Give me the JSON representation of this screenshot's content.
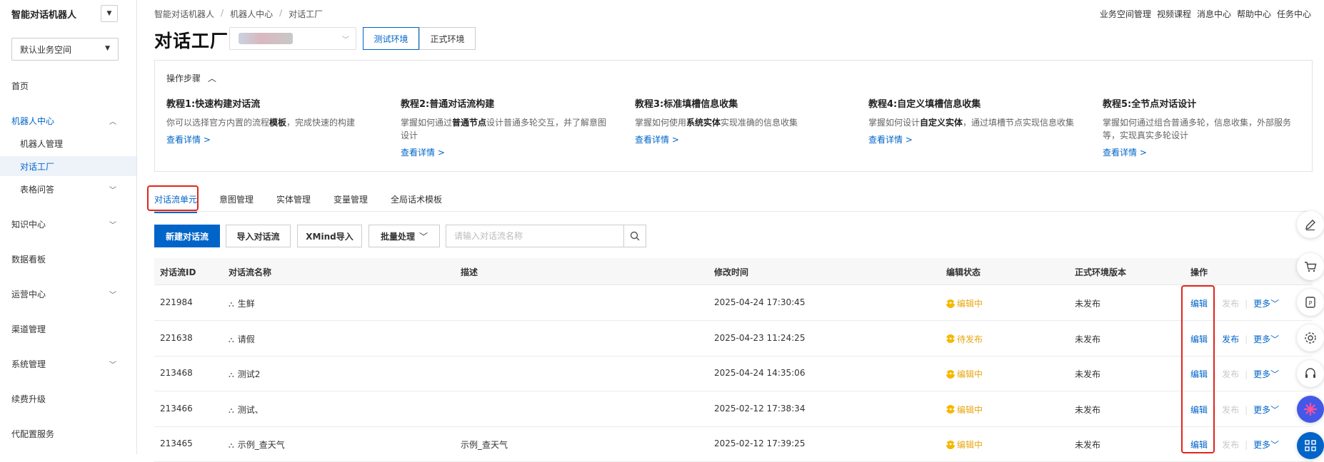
{
  "sidebar": {
    "brand": "智能对话机器人",
    "workspace": "默认业务空间",
    "items": [
      {
        "label": "首页"
      },
      {
        "label": "机器人中心"
      },
      {
        "label": "机器人管理"
      },
      {
        "label": "对话工厂"
      },
      {
        "label": "表格问答"
      },
      {
        "label": "知识中心"
      },
      {
        "label": "数据看板"
      },
      {
        "label": "运营中心"
      },
      {
        "label": "渠道管理"
      },
      {
        "label": "系统管理"
      },
      {
        "label": "续费升级"
      },
      {
        "label": "代配置服务"
      }
    ]
  },
  "header": {
    "breadcrumb": [
      "智能对话机器人",
      "机器人中心",
      "对话工厂"
    ],
    "top_links": [
      "业务空间管理",
      "视频课程",
      "消息中心",
      "帮助中心",
      "任务中心"
    ],
    "title": "对话工厂",
    "env_test": "测试环境",
    "env_prod": "正式环境"
  },
  "tutorials": {
    "header": "操作步骤",
    "items": [
      {
        "title": "教程1:快速构建对话流",
        "desc_pre": "你可以选择官方内置的流程",
        "desc_bold": "模板",
        "desc_post": "，完成快速的构建",
        "link": "查看详情 >"
      },
      {
        "title": "教程2:普通对话流构建",
        "desc_pre": "掌握如何通过",
        "desc_bold": "普通节点",
        "desc_post": "设计普通多轮交互，并了解意图设计",
        "link": "查看详情 >"
      },
      {
        "title": "教程3:标准填槽信息收集",
        "desc_pre": "掌握如何使用",
        "desc_bold": "系统实体",
        "desc_post": "实现准确的信息收集",
        "link": "查看详情 >"
      },
      {
        "title": "教程4:自定义填槽信息收集",
        "desc_pre": "掌握如何设计",
        "desc_bold": "自定义实体",
        "desc_post": "，通过填槽节点实现信息收集",
        "link": "查看详情 >"
      },
      {
        "title": "教程5:全节点对话设计",
        "desc_pre": "掌握如何通过组合普通多轮，信息收集，外部服务等，实现真实多轮设计",
        "desc_bold": "",
        "desc_post": "",
        "link": "查看详情 >"
      }
    ]
  },
  "tabs": [
    "对话流单元",
    "意图管理",
    "实体管理",
    "变量管理",
    "全局话术模板"
  ],
  "toolbar": {
    "new_flow": "新建对话流",
    "import_flow": "导入对话流",
    "xmind_import": "XMind导入",
    "batch": "批量处理",
    "search_placeholder": "请输入对话流名称"
  },
  "table": {
    "columns": [
      "对话流ID",
      "对话流名称",
      "描述",
      "修改时间",
      "编辑状态",
      "正式环境版本",
      "操作"
    ],
    "rows": [
      {
        "id": "221984",
        "name": "生鲜",
        "desc": "",
        "modified": "2025-04-24 17:30:45",
        "status": "编辑中",
        "prod_version": "未发布",
        "edit": "编辑",
        "publish": "发布",
        "publish_enabled": false,
        "more": "更多"
      },
      {
        "id": "221638",
        "name": "请假",
        "desc": "",
        "modified": "2025-04-23 11:24:25",
        "status": "待发布",
        "prod_version": "未发布",
        "edit": "编辑",
        "publish": "发布",
        "publish_enabled": true,
        "more": "更多"
      },
      {
        "id": "213468",
        "name": "测试2",
        "desc": "",
        "modified": "2025-04-24 14:35:06",
        "status": "编辑中",
        "prod_version": "未发布",
        "edit": "编辑",
        "publish": "发布",
        "publish_enabled": false,
        "more": "更多"
      },
      {
        "id": "213466",
        "name": "测试、",
        "desc": "",
        "modified": "2025-02-12 17:38:34",
        "status": "编辑中",
        "prod_version": "未发布",
        "edit": "编辑",
        "publish": "发布",
        "publish_enabled": false,
        "more": "更多"
      },
      {
        "id": "213465",
        "name": "示例_查天气",
        "desc": "示例_查天气",
        "modified": "2025-02-12 17:39:25",
        "status": "编辑中",
        "prod_version": "未发布",
        "edit": "编辑",
        "publish": "发布",
        "publish_enabled": false,
        "more": "更多"
      }
    ]
  },
  "colors": {
    "accent": "#0064c8",
    "status_yellow": "#f5b800",
    "highlight_red": "#e0261c"
  },
  "float_icons": [
    "edit-icon",
    "cart-icon",
    "ai-chat-icon",
    "gear-icon",
    "headset-icon",
    "brand-assistant-icon",
    "apps-grid-icon"
  ]
}
